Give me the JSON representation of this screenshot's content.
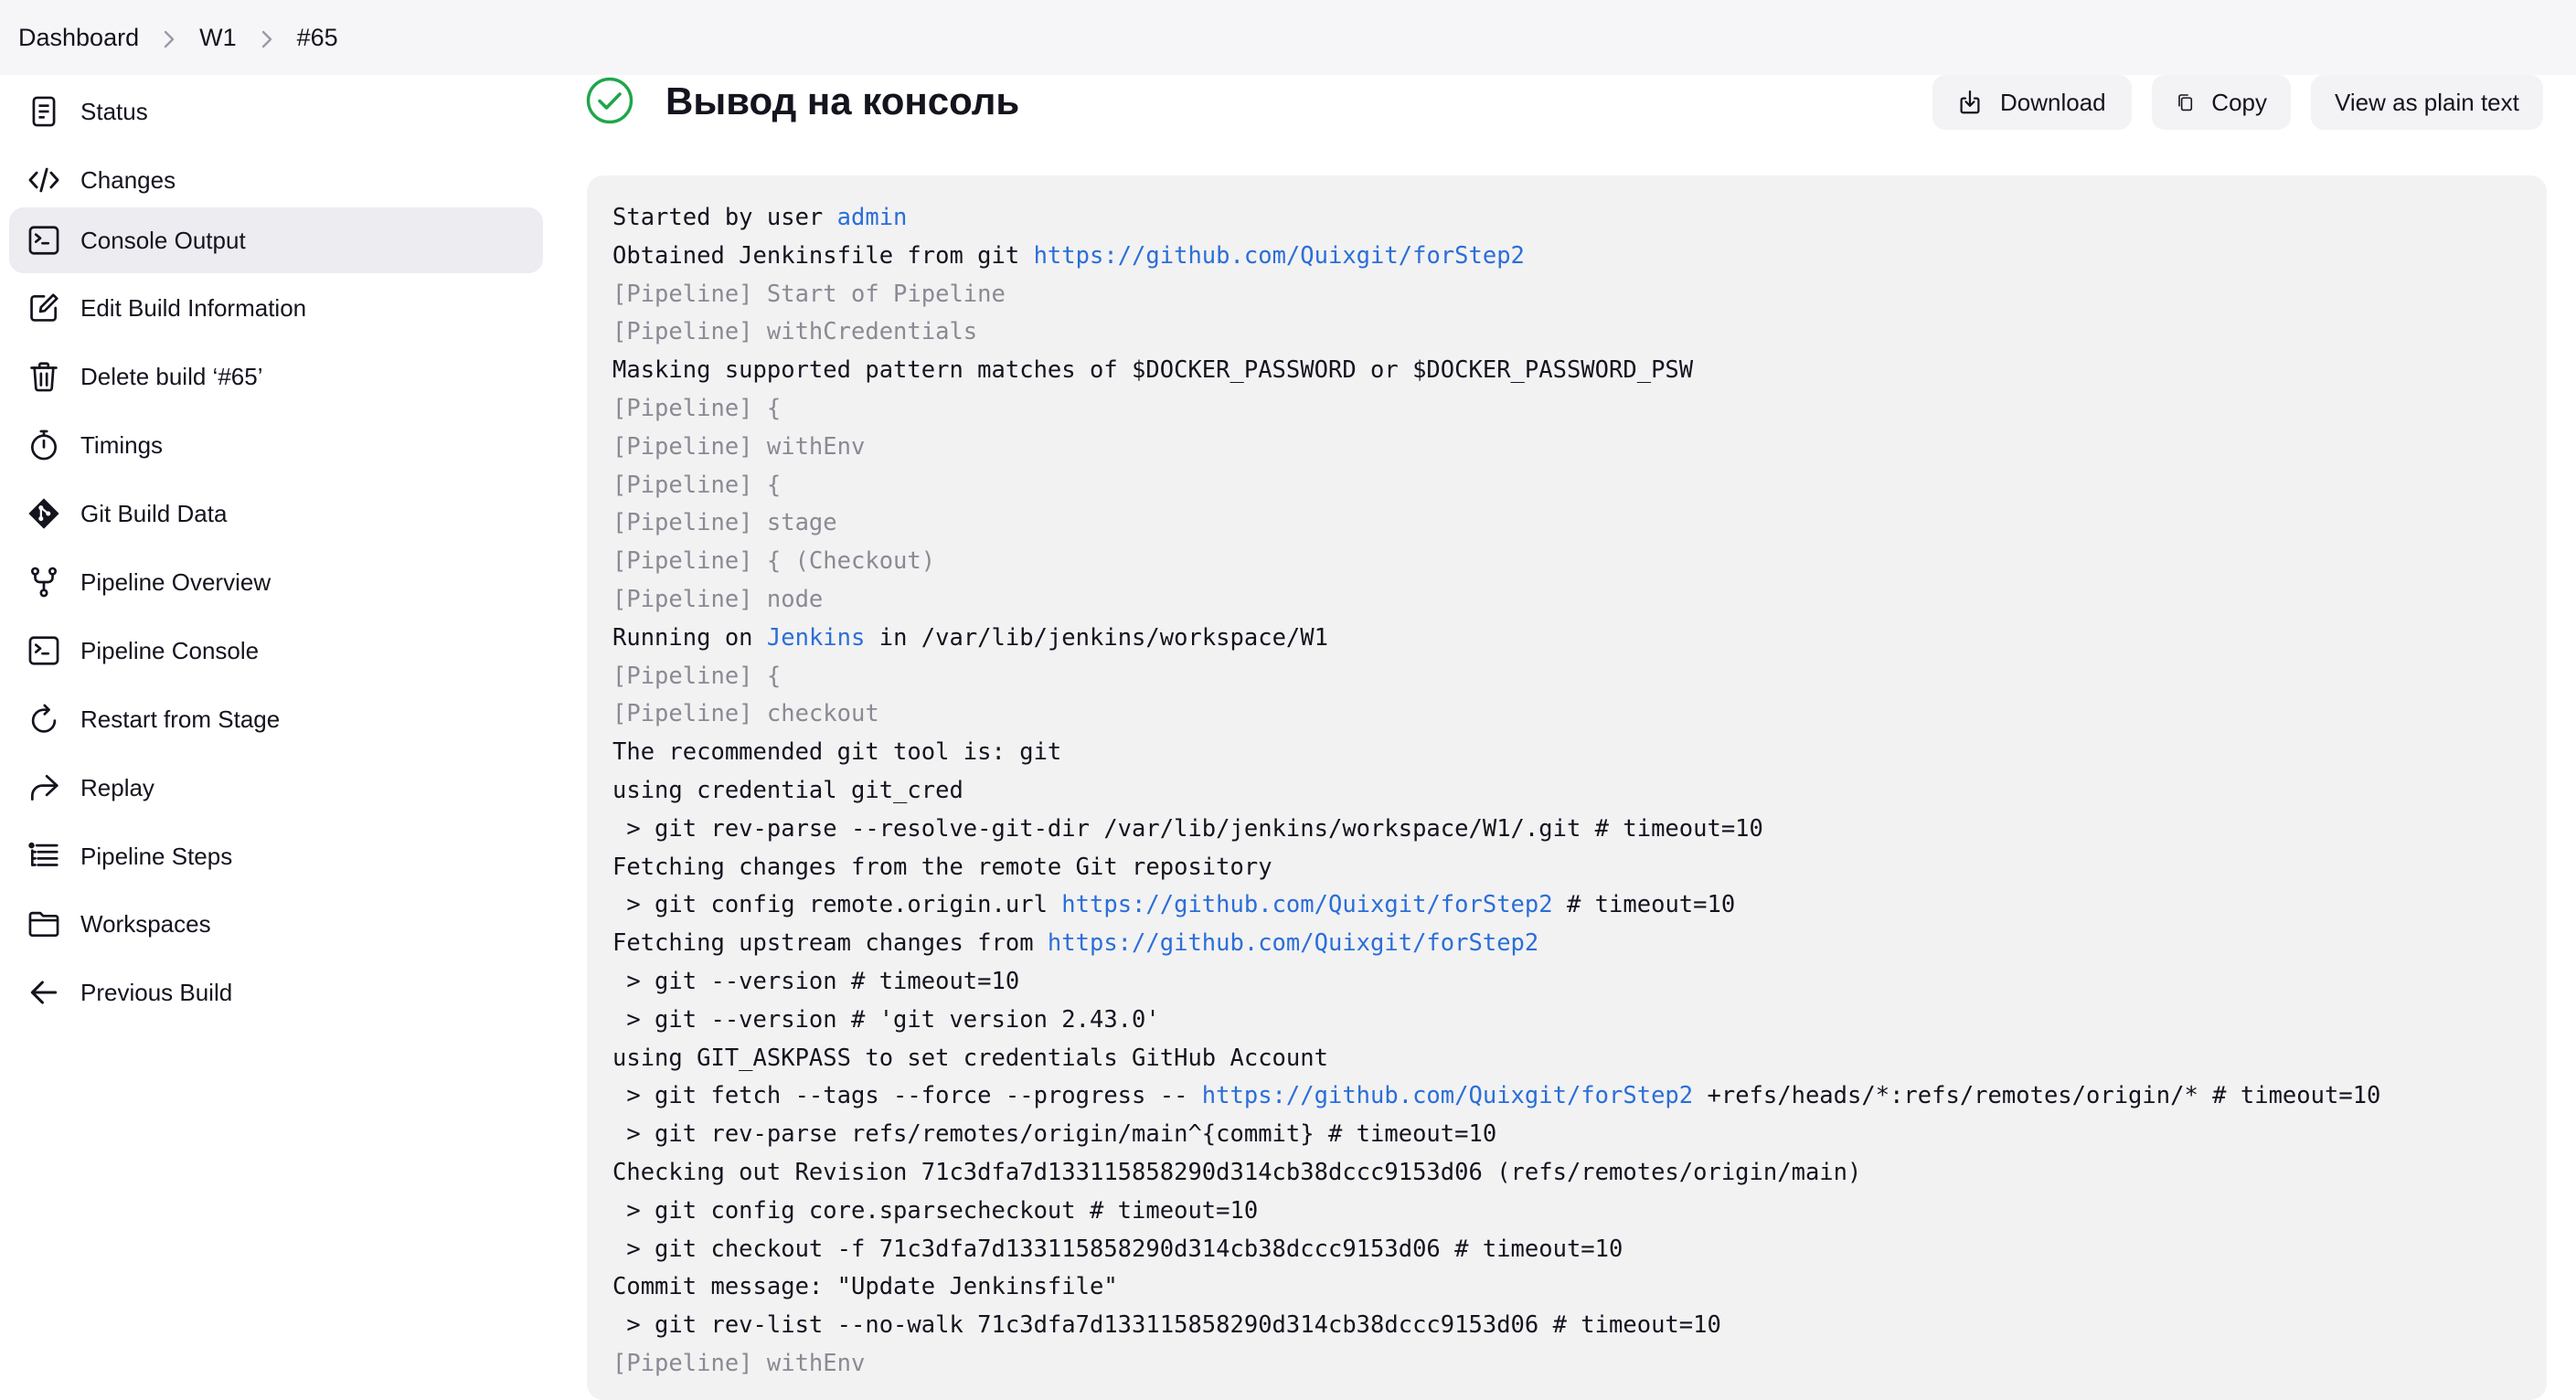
{
  "breadcrumb": {
    "items": [
      "Dashboard",
      "W1",
      "#65"
    ]
  },
  "sidebar": {
    "items": [
      {
        "label": "Status",
        "icon": "document-icon"
      },
      {
        "label": "Changes",
        "icon": "code-icon"
      },
      {
        "label": "Console Output",
        "icon": "terminal-icon",
        "active": true
      },
      {
        "label": "Edit Build Information",
        "icon": "edit-icon"
      },
      {
        "label": "Delete build ‘#65’",
        "icon": "trash-icon"
      },
      {
        "label": "Timings",
        "icon": "stopwatch-icon"
      },
      {
        "label": "Git Build Data",
        "icon": "git-icon"
      },
      {
        "label": "Pipeline Overview",
        "icon": "branch-icon"
      },
      {
        "label": "Pipeline Console",
        "icon": "terminal-icon"
      },
      {
        "label": "Restart from Stage",
        "icon": "restart-icon"
      },
      {
        "label": "Replay",
        "icon": "replay-icon"
      },
      {
        "label": "Pipeline Steps",
        "icon": "list-icon"
      },
      {
        "label": "Workspaces",
        "icon": "folder-icon"
      },
      {
        "label": "Previous Build",
        "icon": "arrow-left-icon"
      }
    ]
  },
  "main": {
    "title": "Вывод на консоль",
    "status_color": "#1ea64b",
    "buttons": {
      "download": "Download",
      "copy": "Copy",
      "plain": "View as plain text"
    }
  },
  "console": {
    "lines": [
      {
        "parts": [
          {
            "t": "Started by user "
          },
          {
            "t": "admin",
            "c": "lnk"
          }
        ]
      },
      {
        "parts": [
          {
            "t": "Obtained Jenkinsfile from git "
          },
          {
            "t": "https://github.com/Quixgit/forStep2",
            "c": "lnk"
          }
        ]
      },
      {
        "parts": [
          {
            "t": "[Pipeline] Start of Pipeline",
            "c": "dim"
          }
        ]
      },
      {
        "parts": [
          {
            "t": "[Pipeline] withCredentials",
            "c": "dim"
          }
        ]
      },
      {
        "parts": [
          {
            "t": "Masking supported pattern matches of $DOCKER_PASSWORD or $DOCKER_PASSWORD_PSW"
          }
        ]
      },
      {
        "parts": [
          {
            "t": "[Pipeline] {",
            "c": "dim"
          }
        ]
      },
      {
        "parts": [
          {
            "t": "[Pipeline] withEnv",
            "c": "dim"
          }
        ]
      },
      {
        "parts": [
          {
            "t": "[Pipeline] {",
            "c": "dim"
          }
        ]
      },
      {
        "parts": [
          {
            "t": "[Pipeline] stage",
            "c": "dim"
          }
        ]
      },
      {
        "parts": [
          {
            "t": "[Pipeline] { (Checkout)",
            "c": "dim"
          }
        ]
      },
      {
        "parts": [
          {
            "t": "[Pipeline] node",
            "c": "dim"
          }
        ]
      },
      {
        "parts": [
          {
            "t": "Running on "
          },
          {
            "t": "Jenkins",
            "c": "lnk"
          },
          {
            "t": " in /var/lib/jenkins/workspace/W1"
          }
        ]
      },
      {
        "parts": [
          {
            "t": "[Pipeline] {",
            "c": "dim"
          }
        ]
      },
      {
        "parts": [
          {
            "t": "[Pipeline] checkout",
            "c": "dim"
          }
        ]
      },
      {
        "parts": [
          {
            "t": "The recommended git tool is: git"
          }
        ]
      },
      {
        "parts": [
          {
            "t": "using credential git_cred"
          }
        ]
      },
      {
        "parts": [
          {
            "t": " > git rev-parse --resolve-git-dir /var/lib/jenkins/workspace/W1/.git # timeout=10"
          }
        ]
      },
      {
        "parts": [
          {
            "t": "Fetching changes from the remote Git repository"
          }
        ]
      },
      {
        "parts": [
          {
            "t": " > git config remote.origin.url "
          },
          {
            "t": "https://github.com/Quixgit/forStep2",
            "c": "lnk"
          },
          {
            "t": " # timeout=10"
          }
        ]
      },
      {
        "parts": [
          {
            "t": "Fetching upstream changes from "
          },
          {
            "t": "https://github.com/Quixgit/forStep2",
            "c": "lnk"
          }
        ]
      },
      {
        "parts": [
          {
            "t": " > git --version # timeout=10"
          }
        ]
      },
      {
        "parts": [
          {
            "t": " > git --version # 'git version 2.43.0'"
          }
        ]
      },
      {
        "parts": [
          {
            "t": "using GIT_ASKPASS to set credentials GitHub Account"
          }
        ]
      },
      {
        "parts": [
          {
            "t": " > git fetch --tags --force --progress -- "
          },
          {
            "t": "https://github.com/Quixgit/forStep2",
            "c": "lnk"
          },
          {
            "t": " +refs/heads/*:refs/remotes/origin/* # timeout=10"
          }
        ]
      },
      {
        "parts": [
          {
            "t": " > git rev-parse refs/remotes/origin/main^{commit} # timeout=10"
          }
        ]
      },
      {
        "parts": [
          {
            "t": "Checking out Revision 71c3dfa7d133115858290d314cb38dccc9153d06 (refs/remotes/origin/main)"
          }
        ]
      },
      {
        "parts": [
          {
            "t": " > git config core.sparsecheckout # timeout=10"
          }
        ]
      },
      {
        "parts": [
          {
            "t": " > git checkout -f 71c3dfa7d133115858290d314cb38dccc9153d06 # timeout=10"
          }
        ]
      },
      {
        "parts": [
          {
            "t": "Commit message: \"Update Jenkinsfile\""
          }
        ]
      },
      {
        "parts": [
          {
            "t": " > git rev-list --no-walk 71c3dfa7d133115858290d314cb38dccc9153d06 # timeout=10"
          }
        ]
      },
      {
        "parts": [
          {
            "t": "[Pipeline] withEnv",
            "c": "dim"
          }
        ]
      }
    ]
  }
}
